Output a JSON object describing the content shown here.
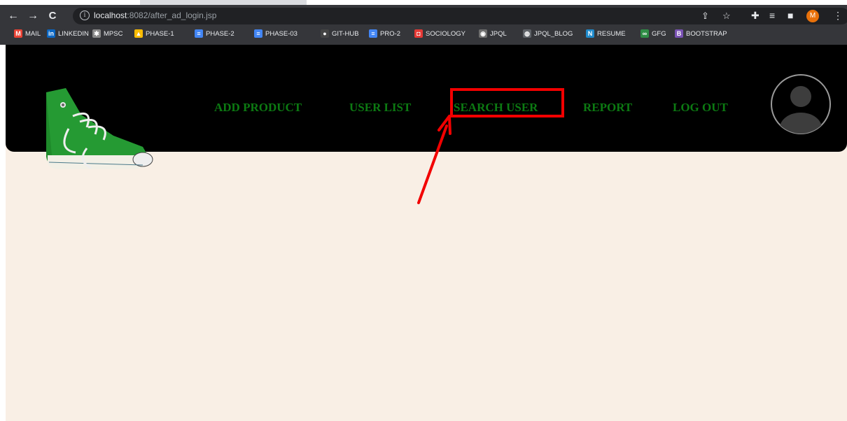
{
  "browser": {
    "url_host": "localhost",
    "url_rest": ":8082/after_ad_login.jsp",
    "profile_initial": "M",
    "bookmarks": [
      {
        "label": "MAIL",
        "icon": "gmail-icon",
        "color": "#ea4335",
        "glyph": "M"
      },
      {
        "label": "LINKEDIN",
        "icon": "linkedin-icon",
        "color": "#0a66c2",
        "glyph": "in"
      },
      {
        "label": "MPSC",
        "icon": "emblem-icon",
        "color": "#8a8a8a",
        "glyph": "✱"
      },
      {
        "label": "PHASE-1",
        "icon": "drive-icon",
        "color": "#fbbc04",
        "glyph": "▲"
      },
      {
        "label": "PHASE-2",
        "icon": "docs-icon",
        "color": "#4285f4",
        "glyph": "≡"
      },
      {
        "label": "PHASE-03",
        "icon": "docs-icon",
        "color": "#4285f4",
        "glyph": "≡"
      },
      {
        "label": "GIT-HUB",
        "icon": "github-icon",
        "color": "#444444",
        "glyph": "●"
      },
      {
        "label": "PRO-2",
        "icon": "docs-icon",
        "color": "#4285f4",
        "glyph": "≡"
      },
      {
        "label": "SOCIOLOGY",
        "icon": "media-icon",
        "color": "#e53935",
        "glyph": "◘"
      },
      {
        "label": "JPQL",
        "icon": "jpql-icon",
        "color": "#6d6d6d",
        "glyph": "◉"
      },
      {
        "label": "JPQL_BLOG",
        "icon": "globe-icon",
        "color": "#5f6368",
        "glyph": "◍"
      },
      {
        "label": "RESUME",
        "icon": "resume-icon",
        "color": "#1f8acb",
        "glyph": "N"
      },
      {
        "label": "GFG",
        "icon": "gfg-icon",
        "color": "#2f8d46",
        "glyph": "∞"
      },
      {
        "label": "BOOTSTRAP",
        "icon": "bootstrap-icon",
        "color": "#7952b3",
        "glyph": "B"
      }
    ]
  },
  "site": {
    "nav": [
      "ADD PRODUCT",
      "USER LIST",
      "SEARCH USER",
      "REPORT",
      "LOG OUT"
    ],
    "link_color": "#0c7a12",
    "header_color": "#000000",
    "background_color": "#f9efe5"
  },
  "annotation": {
    "target": "SEARCH USER",
    "color": "#f20000"
  }
}
